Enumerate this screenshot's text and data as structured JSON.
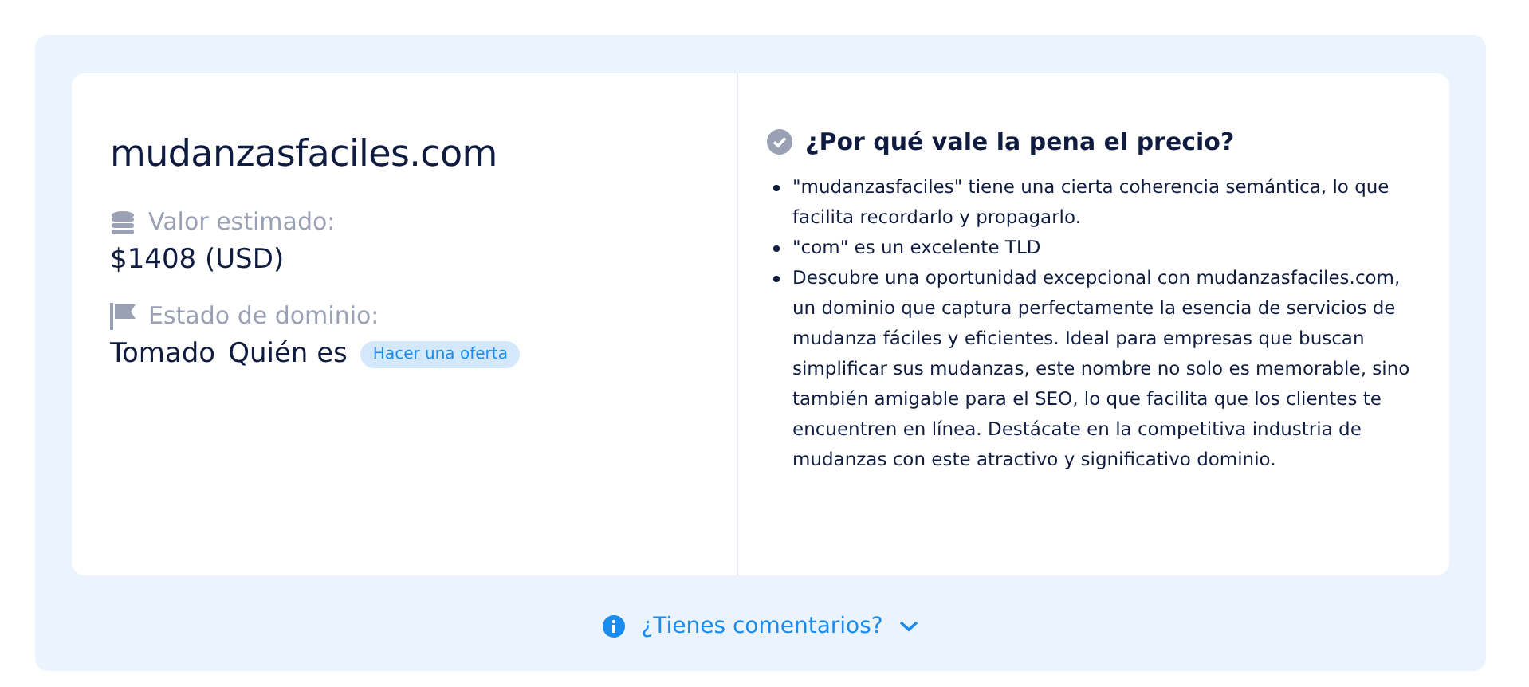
{
  "domain": "mudanzasfaciles.com",
  "value": {
    "label": "Valor estimado:",
    "amount": "$1408 (USD)"
  },
  "status": {
    "label": "Estado de dominio:",
    "state": "Tomado",
    "whois": "Quién es",
    "offer_button": "Hacer una oferta"
  },
  "reasons": {
    "title": "¿Por qué vale la pena el precio?",
    "items": [
      "\"mudanzasfaciles\" tiene una cierta coherencia semántica, lo que facilita recordarlo y propagarlo.",
      "\"com\" es un excelente TLD",
      "Descubre una oportunidad excepcional con mudanzasfaciles.com, un dominio que captura perfectamente la esencia de servicios de mudanza fáciles y eficientes. Ideal para empresas que buscan simplificar sus mudanzas, este nombre no solo es memorable, sino también amigable para el SEO, lo que facilita que los clientes te encuentren en línea. Destácate en la competitiva industria de mudanzas con este atractivo y significativo dominio."
    ]
  },
  "feedback": {
    "label": "¿Tienes comentarios?",
    "expanded": false
  }
}
